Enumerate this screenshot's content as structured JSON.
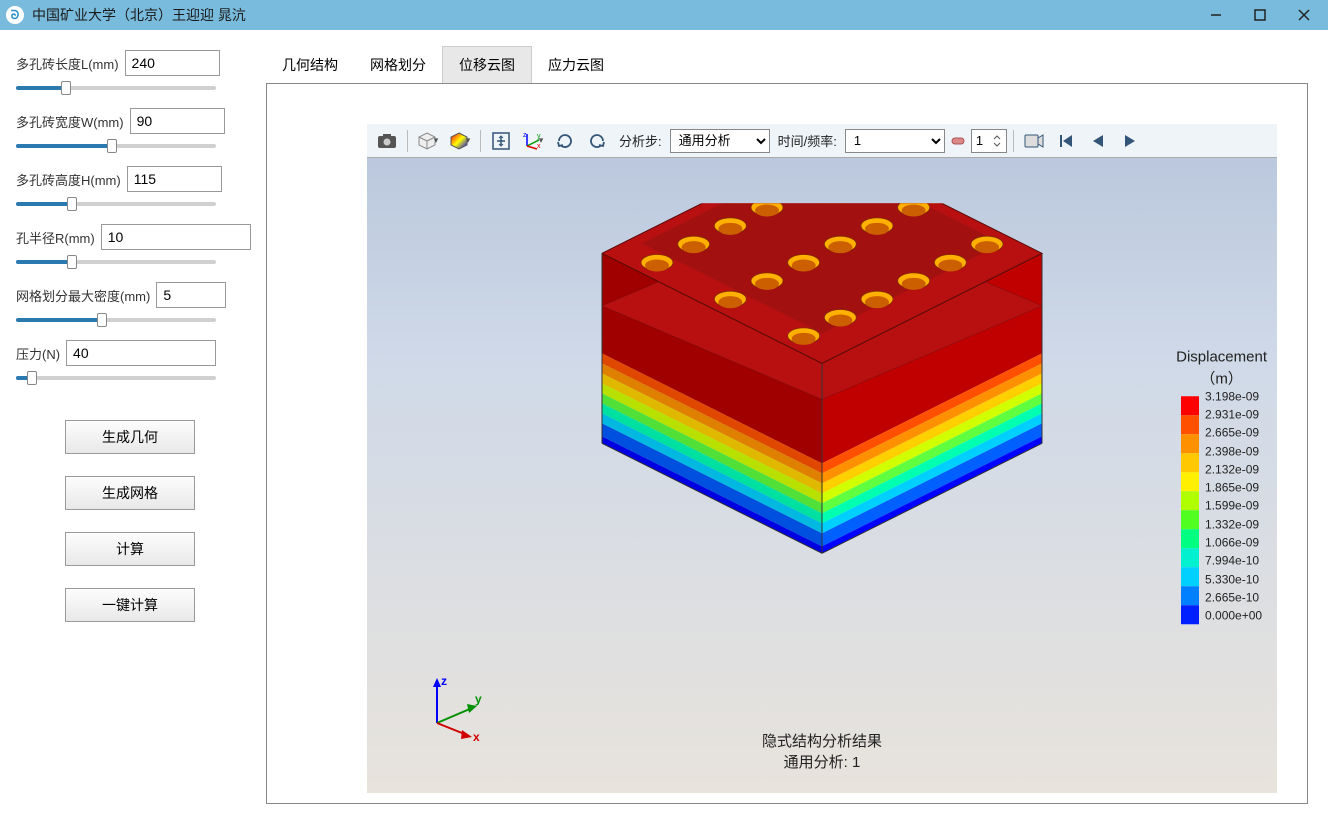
{
  "window": {
    "title": "中国矿业大学（北京）王迎迎 晁沆"
  },
  "params": {
    "length": {
      "label": "多孔砖长度L(mm)",
      "value": "240",
      "slider_pct": 25
    },
    "width": {
      "label": "多孔砖宽度W(mm)",
      "value": "90",
      "slider_pct": 48
    },
    "height": {
      "label": "多孔砖高度H(mm)",
      "value": "115",
      "slider_pct": 28
    },
    "radius": {
      "label": "孔半径R(mm)",
      "value": "10",
      "slider_pct": 28
    },
    "mesh": {
      "label": "网格划分最大密度(mm)",
      "value": "5",
      "slider_pct": 43
    },
    "pressure": {
      "label": "压力(N)",
      "value": "40",
      "slider_pct": 8
    }
  },
  "buttons": {
    "gen_geom": "生成几何",
    "gen_mesh": "生成网格",
    "compute": "计算",
    "one_click": "一键计算"
  },
  "tabs": {
    "geom": "几何结构",
    "mesh": "网格划分",
    "disp": "位移云图",
    "stress": "应力云图",
    "active": "disp"
  },
  "toolbar": {
    "analysis_step_label": "分析步:",
    "analysis_step_value": "通用分析",
    "time_freq_label": "时间/频率:",
    "time_freq_value": "1",
    "spin_value": "1"
  },
  "caption": {
    "line1": "隐式结构分析结果",
    "line2": "通用分析: 1"
  },
  "axes": {
    "x": "x",
    "y": "y",
    "z": "z"
  },
  "legend": {
    "title": "Displacement",
    "unit": "（m）",
    "colors": [
      "#ff0000",
      "#ff5000",
      "#ff9000",
      "#ffc800",
      "#fff000",
      "#b0ff00",
      "#50ff20",
      "#00ff80",
      "#00f0d0",
      "#00d0ff",
      "#0080ff",
      "#0020ff"
    ],
    "values": [
      "3.198e-09",
      "2.931e-09",
      "2.665e-09",
      "2.398e-09",
      "2.132e-09",
      "1.865e-09",
      "1.599e-09",
      "1.332e-09",
      "1.066e-09",
      "7.994e-10",
      "5.330e-10",
      "2.665e-10",
      "0.000e+00"
    ]
  }
}
